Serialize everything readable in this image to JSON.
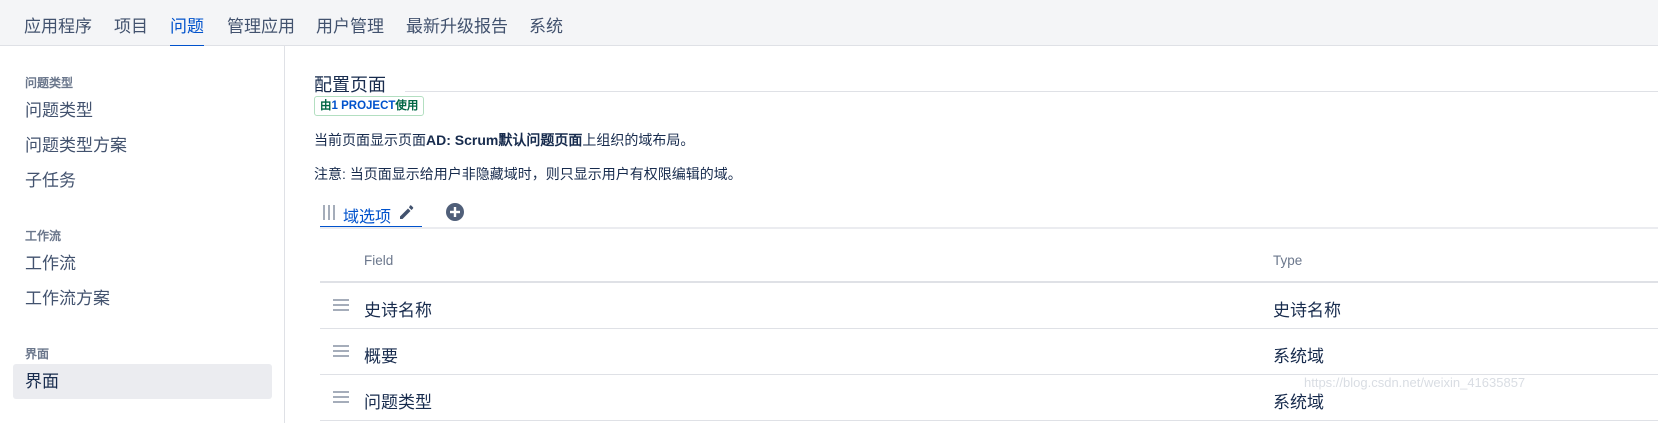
{
  "topnav": {
    "items": [
      {
        "label": "应用程序"
      },
      {
        "label": "项目"
      },
      {
        "label": "问题",
        "active": true
      },
      {
        "label": "管理应用"
      },
      {
        "label": "用户管理"
      },
      {
        "label": "最新升级报告"
      },
      {
        "label": "系统"
      }
    ]
  },
  "sidebar": {
    "sections": [
      {
        "heading": "问题类型",
        "items": [
          "问题类型",
          "问题类型方案",
          "子任务"
        ]
      },
      {
        "heading": "工作流",
        "items": [
          "工作流",
          "工作流方案"
        ]
      },
      {
        "heading": "界面",
        "items": [
          "界面"
        ],
        "selected": "界面"
      }
    ]
  },
  "main": {
    "title": "配置页面",
    "lozenge": {
      "prefix": "由",
      "project": "1 PROJECT",
      "suffix": "使用"
    },
    "description": {
      "before": "当前页面显示页面",
      "bold": "AD: Scrum默认问题页面",
      "after": "上组织的域布局。"
    },
    "note": "注意: 当页面显示给用户非隐藏域时，则只显示用户有权限编辑的域。",
    "tab": {
      "label": "域选项",
      "icons": [
        "drag-handle-icon",
        "pencil-icon",
        "add-circle-icon"
      ]
    },
    "table": {
      "columns": [
        "Field",
        "Type"
      ],
      "rows": [
        {
          "field": "史诗名称",
          "type": "史诗名称"
        },
        {
          "field": "概要",
          "type": "系统域"
        },
        {
          "field": "问题类型",
          "type": "系统域"
        }
      ]
    }
  },
  "watermark": "https://blog.csdn.net/weixin_41635857",
  "colors": {
    "accent": "#0052cc",
    "text": "#172b4d",
    "muted": "#6b778c",
    "success": "#006644"
  }
}
